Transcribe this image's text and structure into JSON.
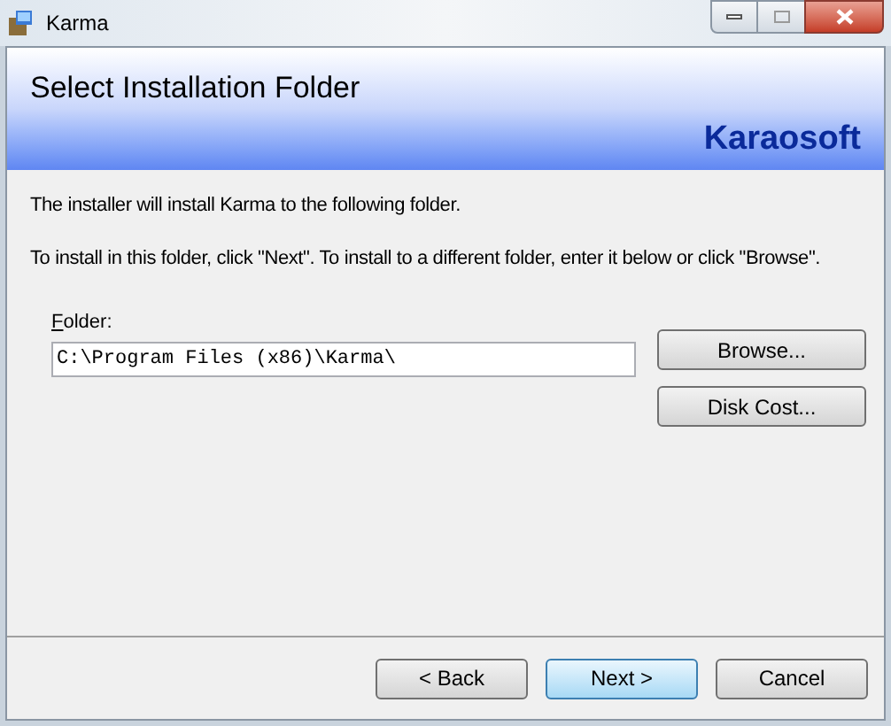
{
  "window": {
    "title": "Karma"
  },
  "banner": {
    "title": "Select Installation Folder",
    "brand": "Karaosoft"
  },
  "paragraphs": [
    "The installer will install Karma to the following folder.",
    "To install in this folder, click \"Next\". To install to a different folder, enter it below or click \"Browse\"."
  ],
  "folder": {
    "label": "Folder:",
    "first_letter_underlined": true,
    "value": "C:\\Program Files (x86)\\Karma\\"
  },
  "side_buttons": [
    "Browse...",
    "Disk Cost..."
  ],
  "buttons": [
    {
      "label": "< Back",
      "default": false
    },
    {
      "label": "Next >",
      "default": true
    },
    {
      "label": "Cancel",
      "default": false
    }
  ]
}
